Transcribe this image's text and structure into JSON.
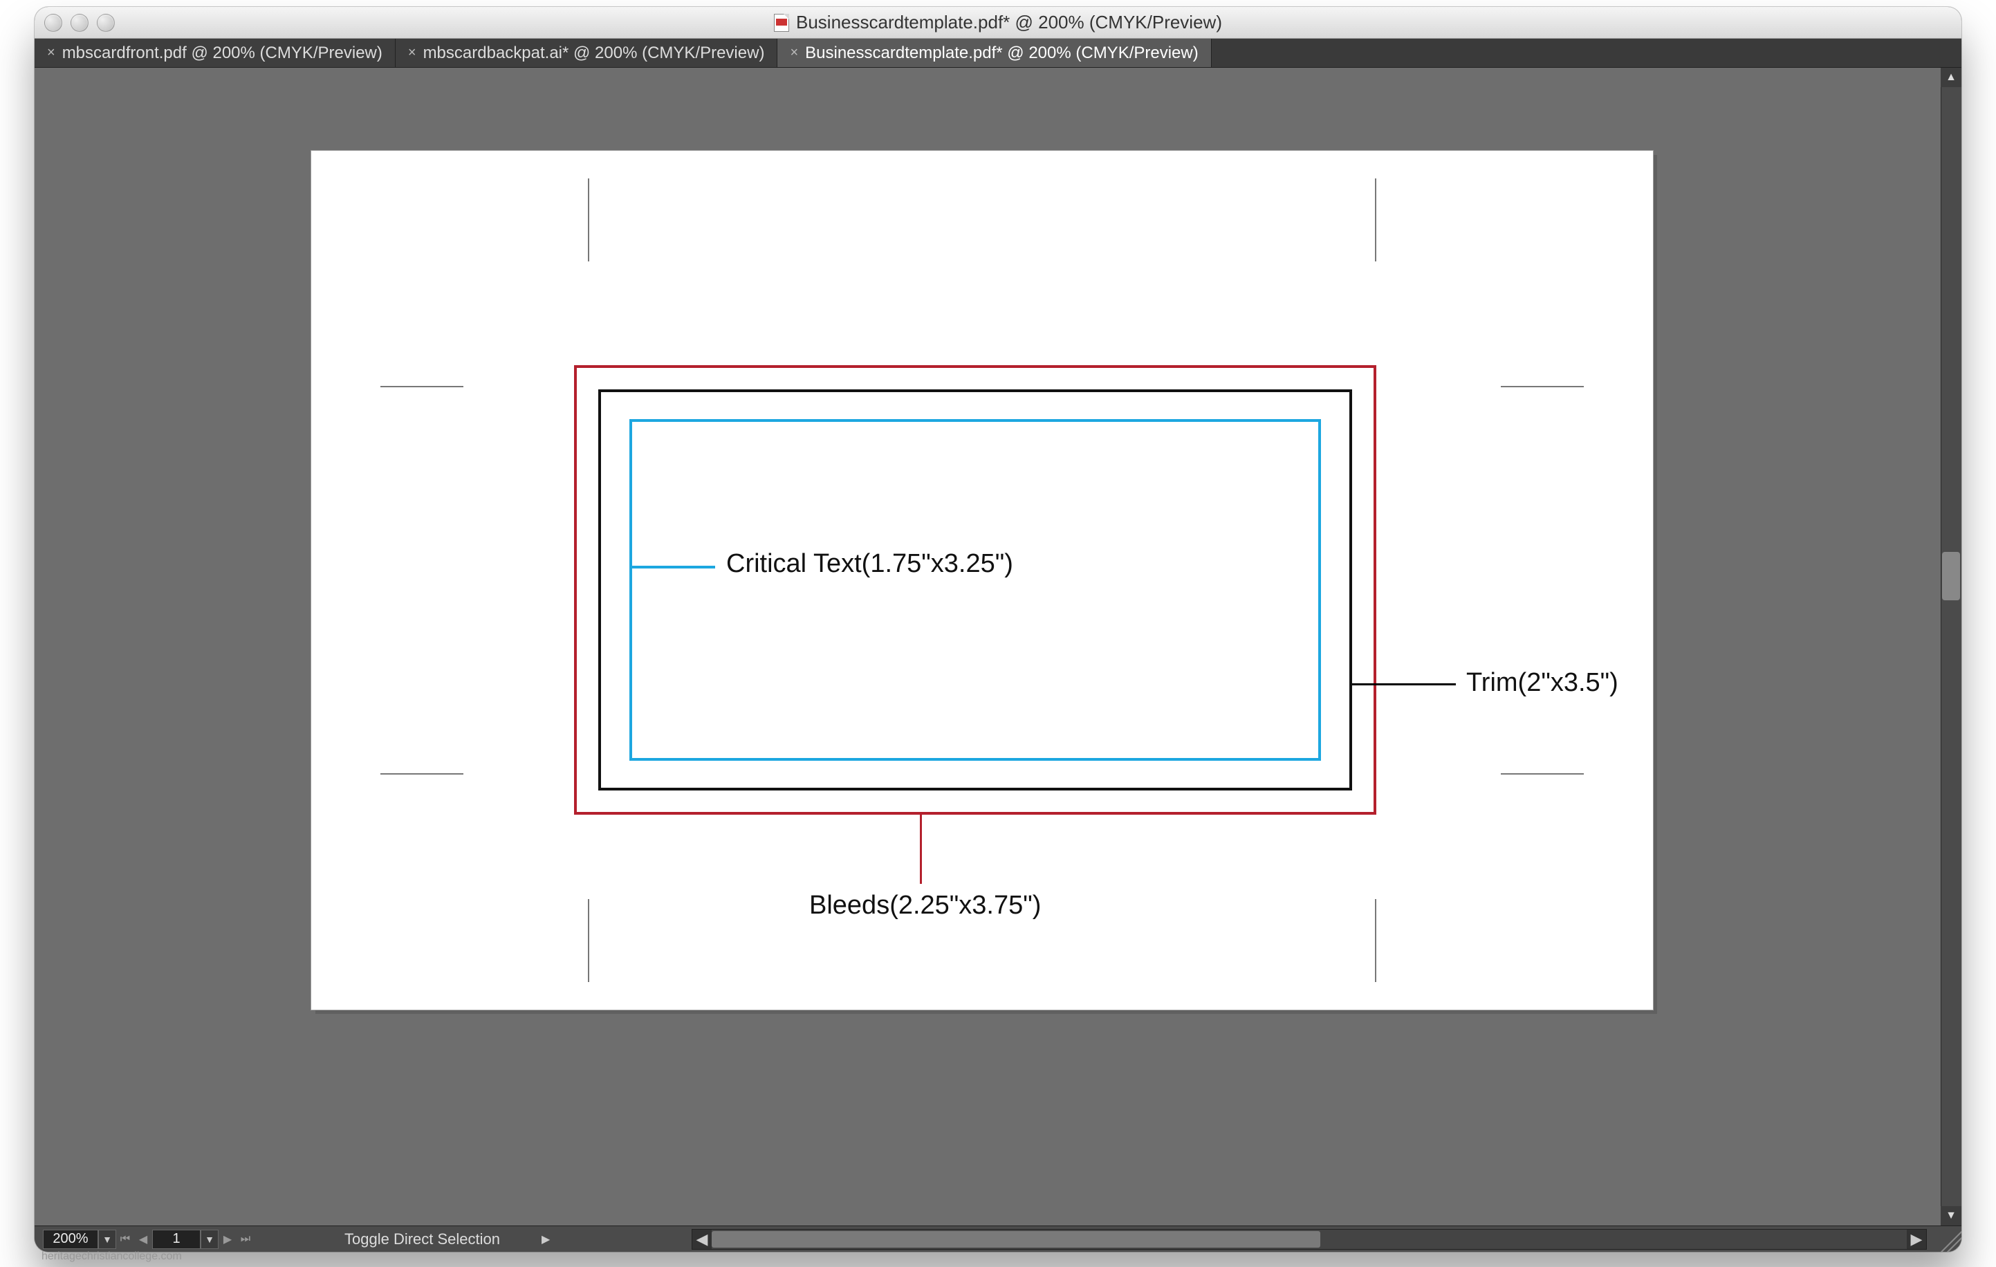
{
  "window": {
    "title": "Businesscardtemplate.pdf* @ 200% (CMYK/Preview)"
  },
  "tabs": [
    {
      "label": "mbscardfront.pdf @ 200% (CMYK/Preview)",
      "active": false
    },
    {
      "label": "mbscardbackpat.ai* @ 200% (CMYK/Preview)",
      "active": false
    },
    {
      "label": "Businesscardtemplate.pdf* @ 200% (CMYK/Preview)",
      "active": true
    }
  ],
  "canvas": {
    "critical_label": "Critical Text(1.75\"x3.25\")",
    "trim_label": "Trim(2\"x3.5\")",
    "bleeds_label": "Bleeds(2.25\"x3.75\")"
  },
  "status": {
    "zoom": "200%",
    "page": "1",
    "mode": "Toggle Direct Selection"
  },
  "watermark": "heritagechristiancollege.com"
}
